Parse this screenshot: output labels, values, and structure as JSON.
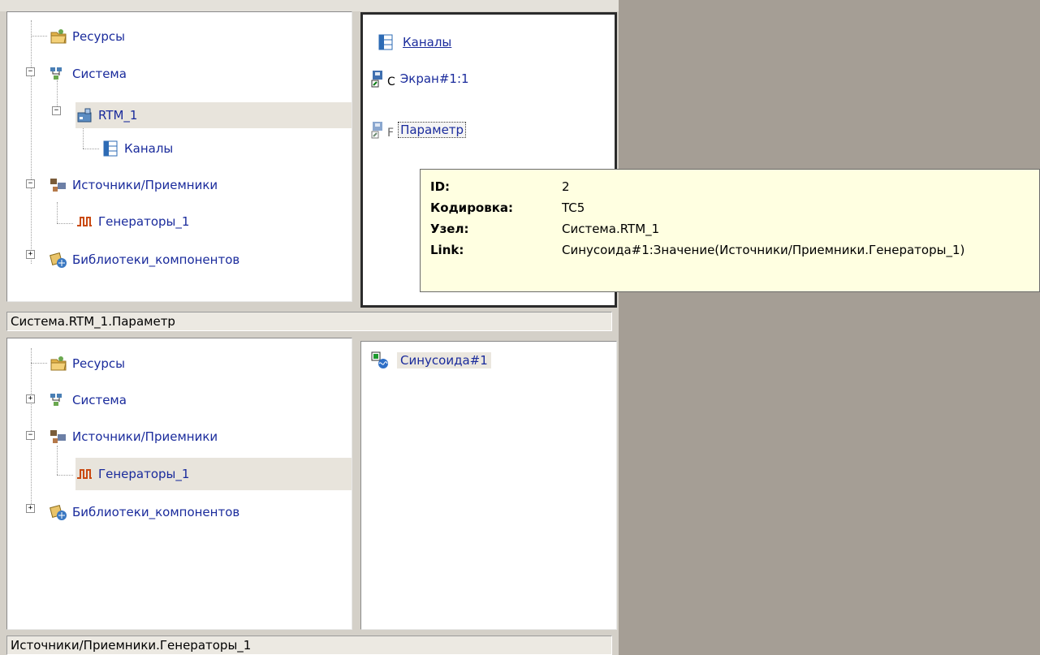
{
  "top_tree": {
    "items": [
      {
        "label": "Ресурсы",
        "icon": "folder-icon"
      },
      {
        "label": "Система",
        "icon": "network-icon"
      },
      {
        "label": "RTM_1",
        "icon": "node-icon"
      },
      {
        "label": "Каналы",
        "icon": "table-icon"
      },
      {
        "label": "Источники/Приемники",
        "icon": "sources-icon"
      },
      {
        "label": "Генераторы_1",
        "icon": "pulse-icon"
      },
      {
        "label": "Библиотеки_компонентов",
        "icon": "library-icon"
      }
    ]
  },
  "top_list": {
    "items": [
      {
        "label": "Каналы",
        "icon": "table-icon",
        "suffix": ""
      },
      {
        "label": "Экран#1:1",
        "icon": "screen-icon",
        "suffix": "C"
      },
      {
        "label": "Параметр",
        "icon": "parameter-icon",
        "suffix": "F"
      }
    ]
  },
  "top_status": "Система.RTM_1.Параметр",
  "bottom_tree": {
    "items": [
      {
        "label": "Ресурсы",
        "icon": "folder-icon"
      },
      {
        "label": "Система",
        "icon": "network-icon"
      },
      {
        "label": "Источники/Приемники",
        "icon": "sources-icon"
      },
      {
        "label": "Генераторы_1",
        "icon": "pulse-icon"
      },
      {
        "label": "Библиотеки_компонентов",
        "icon": "library-icon"
      }
    ]
  },
  "bottom_list": {
    "items": [
      {
        "label": "Синусоида#1",
        "icon": "sinusoid-icon"
      }
    ]
  },
  "bottom_status": "Источники/Приемники.Генераторы_1",
  "tooltip": {
    "rows": [
      {
        "key": "ID:",
        "value": "2"
      },
      {
        "key": "Кодировка:",
        "value": "TC5"
      },
      {
        "key": "Узел:",
        "value": "Система.RTM_1"
      },
      {
        "key": "Link:",
        "value": "Синусоида#1:Значение(Источники/Приемники.Генераторы_1)"
      }
    ]
  },
  "expanders": {
    "minus": "−",
    "plus": "+"
  },
  "colors": {
    "desktop": "#a59e95",
    "panel": "#d4d0c8",
    "tooltip_bg": "#ffffe1",
    "link": "#1a2b9c"
  }
}
